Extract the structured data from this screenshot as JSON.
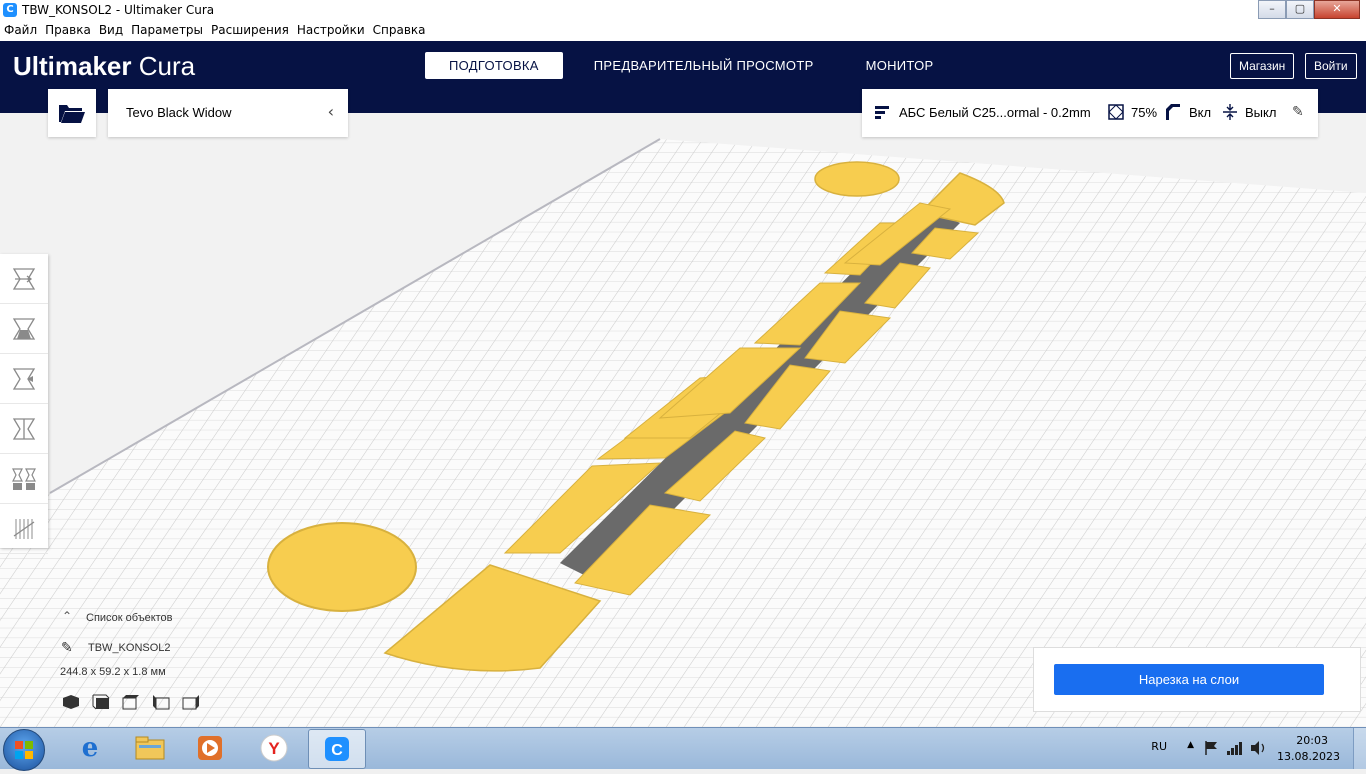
{
  "window": {
    "title": "TBW_KONSOL2 - Ultimaker Cura"
  },
  "menu": [
    "Файл",
    "Правка",
    "Вид",
    "Параметры",
    "Расширения",
    "Настройки",
    "Справка"
  ],
  "header": {
    "logo_bold": "Ultimaker",
    "logo_light": "Cura",
    "tabs": [
      "ПОДГОТОВКА",
      "ПРЕДВАРИТЕЛЬНЫЙ ПРОСМОТР",
      "МОНИТОР"
    ],
    "active_tab": 0,
    "marketplace": "Магазин",
    "signin": "Войти"
  },
  "printer": {
    "name": "Tevo Black Widow"
  },
  "print_settings": {
    "profile": "АБС Белый С25...ormal - 0.2mm",
    "infill": "75%",
    "support": "Вкл",
    "adhesion": "Выкл"
  },
  "objects": {
    "header": "Список объектов",
    "name": "TBW_KONSOL2",
    "dimensions": "244.8 x 59.2 x 1.8 мм"
  },
  "slice_button": "Нарезка на слои",
  "tray": {
    "lang": "RU",
    "time": "20:03",
    "date": "13.08.2023"
  },
  "colors": {
    "header": "#061244",
    "accent": "#196ef0",
    "model": "#f7cd4f"
  }
}
